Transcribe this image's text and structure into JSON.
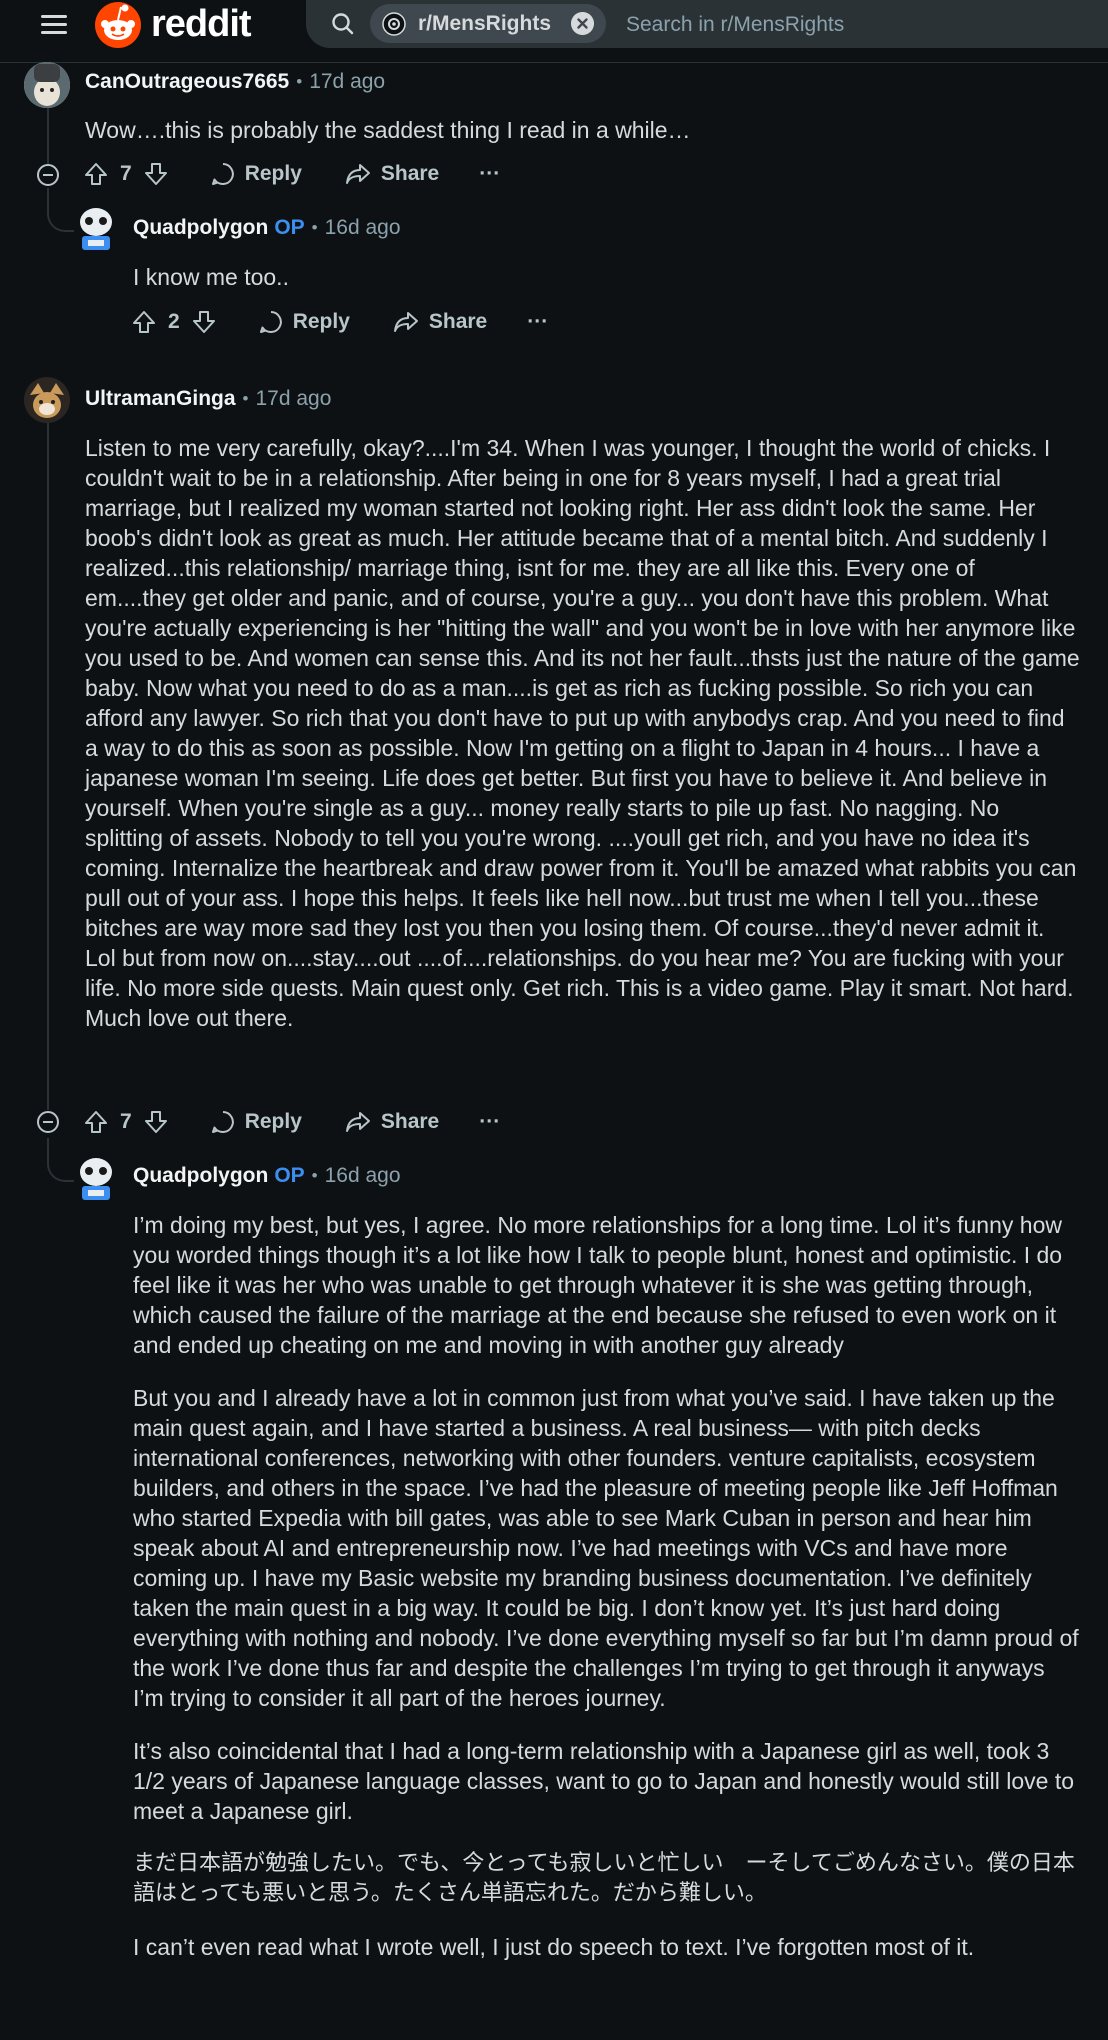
{
  "header": {
    "logo_text": "reddit",
    "subreddit_chip": "r/MensRights",
    "search_placeholder": "Search in r/MensRights"
  },
  "comments": [
    {
      "author": "CanOutrageous7665",
      "time": "17d ago",
      "paragraphs": [
        "Wow….this is probably the saddest thing I read in a while…"
      ],
      "votes": "7",
      "reply": "Reply",
      "share": "Share",
      "more": "···"
    },
    {
      "author": "Quadpolygon",
      "op": "OP",
      "time": "16d ago",
      "paragraphs": [
        "I know me too.."
      ],
      "votes": "2",
      "reply": "Reply",
      "share": "Share",
      "more": "···"
    },
    {
      "author": "UltramanGinga",
      "time": "17d ago",
      "paragraphs": [
        "Listen to me very carefully, okay?....I'm 34. When I was younger, I thought the world of chicks. I couldn't wait to be in a relationship. After being in one for 8 years myself, I had a great trial marriage, but I realized my woman started not looking right. Her ass didn't look the same. Her boob's didn't look as great as much. Her attitude became that of a mental bitch. And suddenly I realized...this relationship/ marriage thing, isnt for me. they are all like this. Every one of em....they get older and panic, and of course, you're a guy... you don't have this problem. What you're actually experiencing is her \"hitting the wall\" and you won't be in love with her anymore like you used to be. And women can sense this. And its not her fault...thsts just the nature of the game baby. Now what you need to do as a man....is get as rich as fucking possible. So rich you can afford any lawyer. So rich that you don't have to put up with anybodys crap. And you need to find a way to do this as soon as possible. Now I'm getting on a flight to Japan in 4 hours... I have a japanese woman I'm seeing. Life does get better. But first you have to believe it. And believe in yourself. When you're single as a guy... money really starts to pile up fast. No nagging. No splitting of assets. Nobody to tell you you're wrong. ....youll get rich, and you have no idea it's coming. Internalize the heartbreak and draw power from it. You'll be amazed what rabbits you can pull out of your ass. I hope this helps. It feels like hell now...but trust me when I tell you...these bitches are way more sad they lost you then you losing them. Of course...they'd never admit it. Lol but from now on....stay....out ....of....relationships. do you hear me? You are fucking with your life. No more side quests. Main quest only. Get rich. This is a video game. Play it smart. Not hard. Much love out there."
      ],
      "votes": "7",
      "reply": "Reply",
      "share": "Share",
      "more": "···"
    },
    {
      "author": "Quadpolygon",
      "op": "OP",
      "time": "16d ago",
      "paragraphs": [
        "I’m doing my best, but yes, I agree. No more relationships for a long time. Lol it’s funny how you worded things though it’s a lot like how I talk to people blunt, honest and optimistic. I do feel like it was her who was unable to get through whatever it is she was getting through, which caused the failure of the marriage at the end because she refused to even work on it and ended up cheating on me and moving in with another guy already",
        "But you and I already have a lot in common just from what you’ve said. I have taken up the main quest again, and I have started a business. A real business— with pitch decks international conferences, networking with other founders. venture capitalists, ecosystem builders, and others in the space. I’ve had the pleasure of meeting people like Jeff Hoffman who started Expedia with bill gates, was able to see Mark Cuban in person and hear him speak about AI and entrepreneurship now. I’ve had meetings with VCs and have more coming up. I have my Basic website my branding business documentation. I’ve definitely taken the main quest in a big way. It could be big. I don’t know yet. It’s just hard doing everything with nothing and nobody. I’ve done everything myself so far but I’m damn proud of the work I’ve done thus far and despite the challenges I’m trying to get through it anyways I’m trying to consider it all part of the heroes journey.",
        "It’s also coincidental that I had a long-term relationship with a Japanese girl as well, took 3 1/2 years of Japanese language classes, want to go to Japan and honestly would still love to meet a Japanese girl.",
        "まだ日本語が勉強したい。でも、今とっても寂しいと忙しい　ーそしてごめんなさい。僕の日本語はとっても悪いと思う。たくさん単語忘れた。だから難しい。",
        "I can’t even read what I wrote well, I just do speech to text. I’ve forgotten most of it."
      ]
    }
  ],
  "colors": {
    "background": "#0e1113",
    "op_blue": "#3c8ff0",
    "reddit_orange": "#ff4500",
    "muted": "#8ba2ad"
  }
}
